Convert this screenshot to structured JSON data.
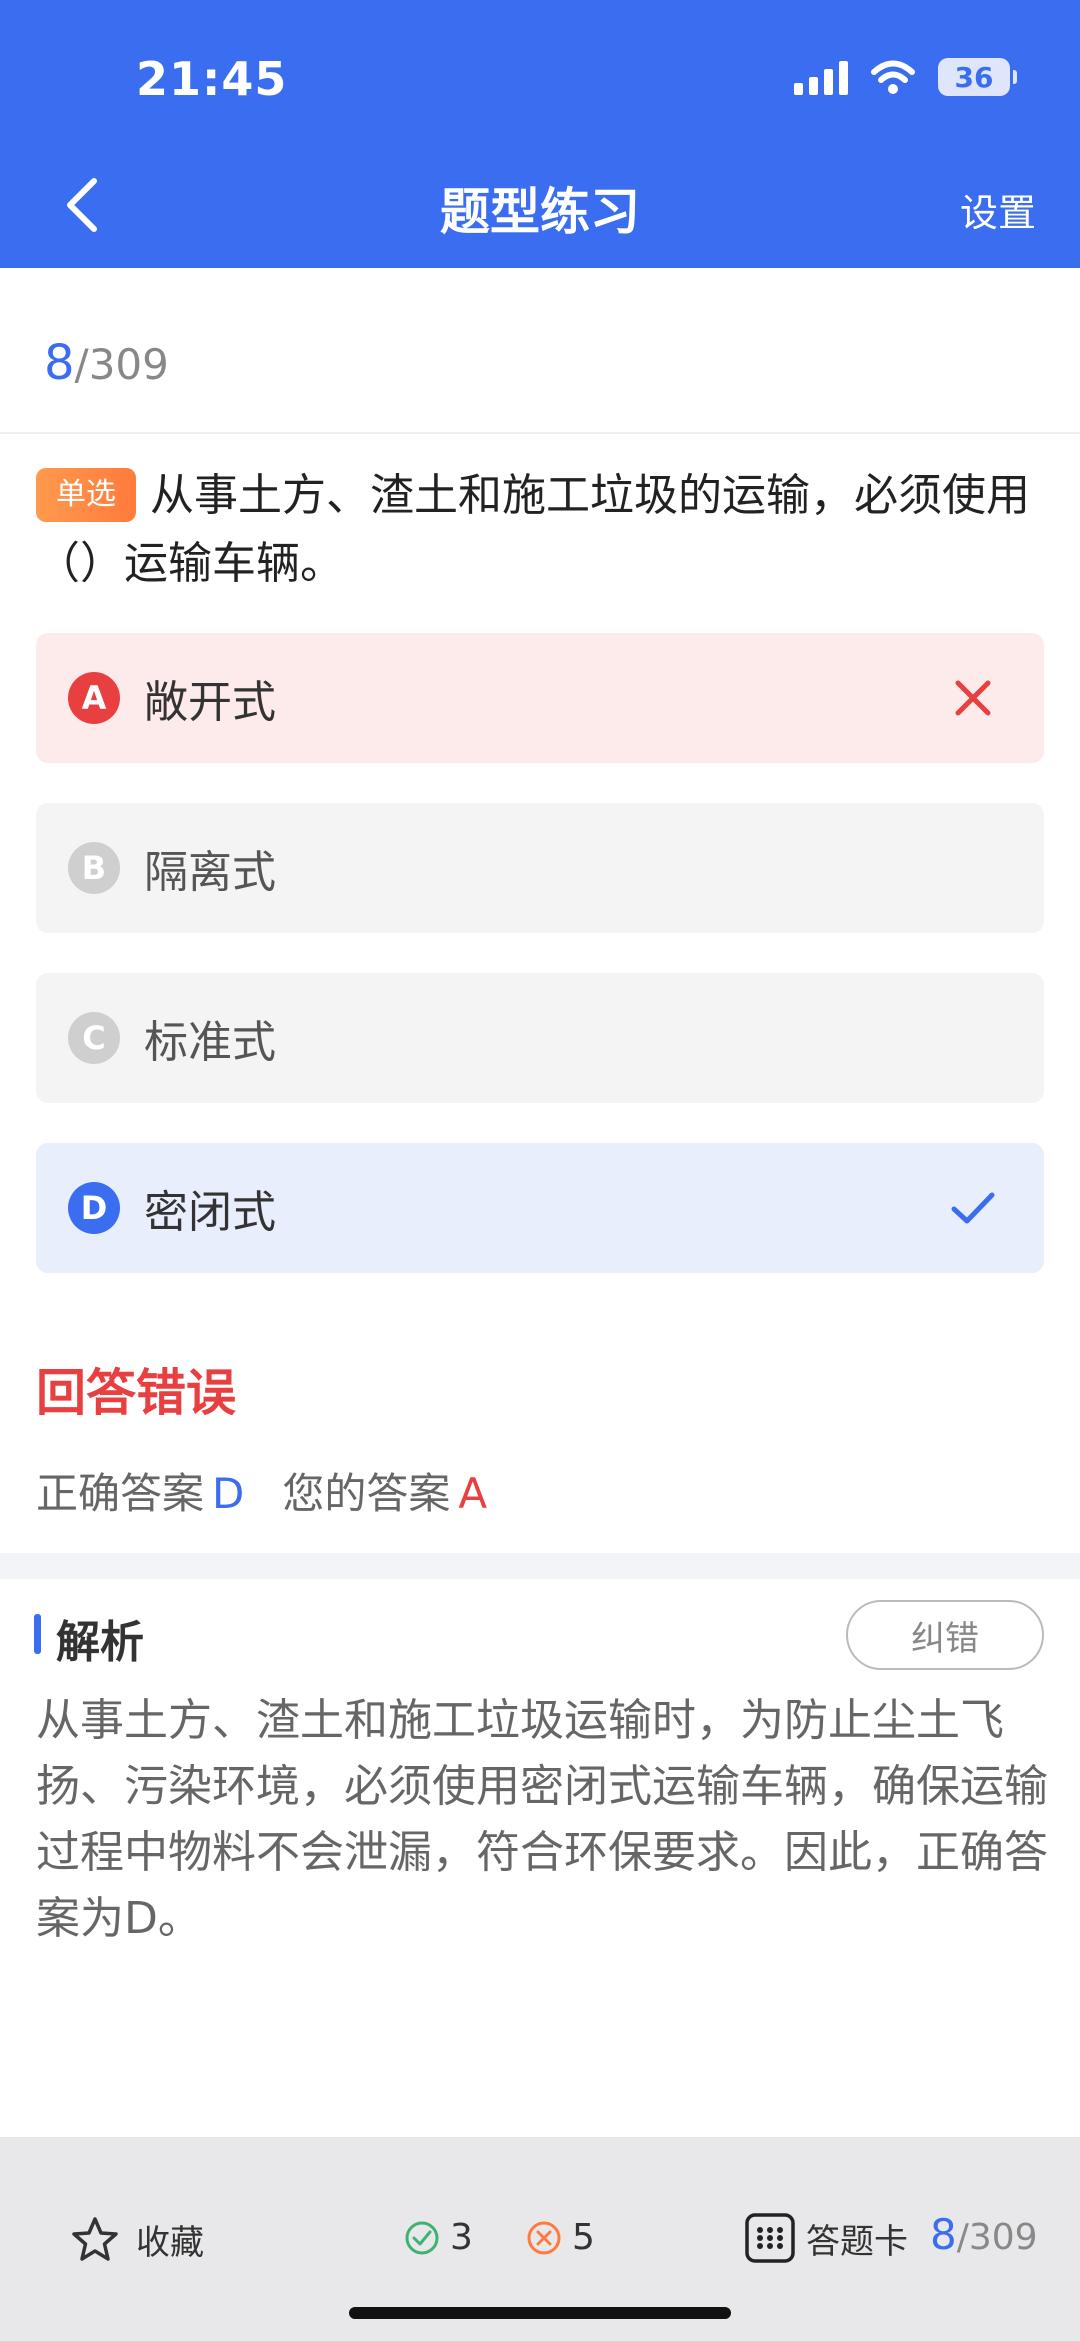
{
  "status_bar": {
    "time": "21:45",
    "battery": "36"
  },
  "nav": {
    "title": "题型练习",
    "settings_label": "设置"
  },
  "progress": {
    "current": "8",
    "total": "/309"
  },
  "question": {
    "type_badge": "单选",
    "text": "从事土方、渣土和施工垃圾的运输，必须使用（）运输车辆。"
  },
  "options": [
    {
      "letter": "A",
      "text": "敞开式",
      "state": "wrong"
    },
    {
      "letter": "B",
      "text": "隔离式",
      "state": "neutral"
    },
    {
      "letter": "C",
      "text": "标准式",
      "state": "neutral"
    },
    {
      "letter": "D",
      "text": "密闭式",
      "state": "correct"
    }
  ],
  "result": {
    "title": "回答错误",
    "correct_label": "正确答案",
    "correct_value": "D",
    "yours_label": "您的答案",
    "yours_value": "A"
  },
  "analysis": {
    "title": "解析",
    "report_label": "纠错",
    "body": "从事土方、渣土和施工垃圾运输时，为防止尘土飞扬、污染环境，必须使用密闭式运输车辆，确保运输过程中物料不会泄漏，符合环保要求。因此，正确答案为D。"
  },
  "bottom_bar": {
    "favorite_label": "收藏",
    "right_count": "3",
    "wrong_count": "5",
    "answer_card_label": "答题卡",
    "progress_current": "8",
    "progress_total": "/309"
  },
  "colors": {
    "primary": "#3a6df0",
    "error": "#e84040",
    "badge": "#ff7a3c",
    "success": "#3cb371"
  }
}
